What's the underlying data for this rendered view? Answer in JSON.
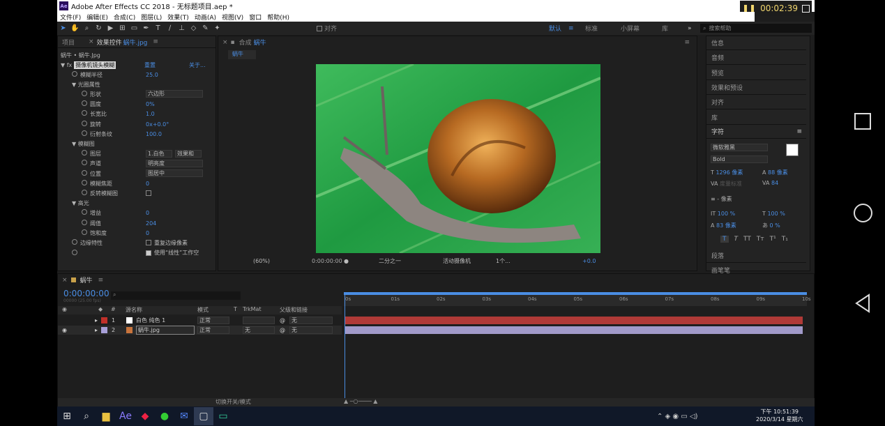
{
  "window": {
    "title": "Adobe After Effects CC 2018 - 无标题项目.aep *",
    "logo": "Ae",
    "recording_time": "00:02:39"
  },
  "menu": [
    "文件(F)",
    "编辑(E)",
    "合成(C)",
    "图层(L)",
    "效果(T)",
    "动画(A)",
    "视图(V)",
    "窗口",
    "帮助(H)"
  ],
  "toolbar": {
    "align_label": "对齐",
    "workspaces": [
      "默认",
      "标准",
      "小屏幕",
      "库"
    ],
    "search_placeholder": "搜索帮助"
  },
  "left_panel": {
    "tab_project": "项目",
    "tab_effects": "效果控件",
    "tab_effects_file": "蜗牛.jpg",
    "breadcrumb": "蜗牛 • 蜗牛.Jpg",
    "effect": {
      "name": "摄像机镜头模糊",
      "reset": "重置",
      "about": "关于..."
    },
    "props": [
      {
        "label": "模糊半径",
        "value": "25.0"
      },
      {
        "label": "光圈属性",
        "value": ""
      },
      {
        "label": "形状",
        "value": "六边形"
      },
      {
        "label": "圆度",
        "value": "0%"
      },
      {
        "label": "长宽比",
        "value": "1.0"
      },
      {
        "label": "旋转",
        "value": "0x+0.0°"
      },
      {
        "label": "衍射条纹",
        "value": "100.0"
      },
      {
        "label": "模糊图",
        "value": ""
      },
      {
        "label": "图层",
        "value": "1.白色",
        "value2": "效果和"
      },
      {
        "label": "声道",
        "value": "明亮度"
      },
      {
        "label": "位置",
        "value": "图居中"
      },
      {
        "label": "模糊焦距",
        "value": "0"
      },
      {
        "label": "反转模糊图",
        "value": ""
      },
      {
        "label": "高光",
        "value": ""
      },
      {
        "label": "增益",
        "value": "0"
      },
      {
        "label": "阈值",
        "value": "204"
      },
      {
        "label": "饱和度",
        "value": "0"
      },
      {
        "label": "边缘特性",
        "value": "重复边缘像素"
      },
      {
        "label": "",
        "value": "使用“线性”工作空"
      }
    ]
  },
  "comp": {
    "tab_label": "合成",
    "tab_name": "蜗牛",
    "subtab": "蜗牛",
    "zoom": "(60%)",
    "timecode": "0:00:00:00",
    "resolution": "二分之一",
    "camera": "活动摄像机",
    "views": "1个...",
    "exposure": "+0.0"
  },
  "right_panel": {
    "items": [
      "信息",
      "音频",
      "预览",
      "效果和预设",
      "对齐",
      "库"
    ],
    "char_title": "字符",
    "font": "微软雅黑",
    "style": "Bold",
    "size": "1296 像素",
    "leading": "88 像素",
    "kerning": "度量标准",
    "tracking": "84",
    "stroke": "- 像素",
    "vscale": "100 %",
    "hscale": "100 %",
    "baseline": "83 像素",
    "tsume": "0 %",
    "para_title": "段落",
    "para_item": "画笔笔"
  },
  "timeline": {
    "tab": "蜗牛",
    "timecode": "0:00:00:00",
    "fps": "00000 (25.00 fps)",
    "cols": {
      "num": "#",
      "source": "源名称",
      "mode": "模式",
      "t": "T",
      "trkmat": "TrkMat",
      "parent": "父级和链接"
    },
    "ticks": [
      "0s",
      "01s",
      "02s",
      "03s",
      "04s",
      "05s",
      "06s",
      "07s",
      "08s",
      "09s",
      "10s"
    ],
    "layers": [
      {
        "num": "1",
        "name": "白色 纯色 1",
        "mode": "正常",
        "trkmat": "",
        "parent": "无",
        "color": "#c0302a",
        "bar": "#b03a37"
      },
      {
        "num": "2",
        "name": "蜗牛.jpg",
        "mode": "正常",
        "trkmat": "无",
        "parent": "无",
        "color": "#a8a0d8",
        "bar": "#a19ac9"
      }
    ],
    "footer": "切换开关/模式"
  },
  "taskbar": {
    "time": "下午 10:51:39",
    "date": "2020/3/14 星期六"
  }
}
